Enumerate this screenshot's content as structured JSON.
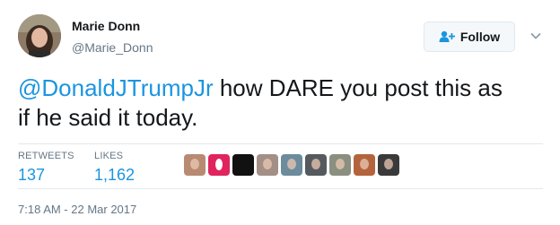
{
  "user": {
    "display_name": "Marie Donn",
    "handle": "@Marie_Donn"
  },
  "follow_button": {
    "label": "Follow",
    "icon": "person-add-icon"
  },
  "menu": {
    "icon": "chevron-down-icon"
  },
  "tweet": {
    "mention": "@DonaldJTrumpJr",
    "text_line1": " how DARE you post this as",
    "text_line2": "if he said it today."
  },
  "stats": {
    "retweets_label": "RETWEETS",
    "retweets_count": "137",
    "likes_label": "LIKES",
    "likes_count": "1,162"
  },
  "liker_avatars": [
    {
      "color": "#b88a72"
    },
    {
      "color": "#e0245e"
    },
    {
      "color": "#111111"
    },
    {
      "color": "#a48f86"
    },
    {
      "color": "#6c8b9c"
    },
    {
      "color": "#555a5e"
    },
    {
      "color": "#8a8f80"
    },
    {
      "color": "#b4643c"
    },
    {
      "color": "#3a3a3a"
    }
  ],
  "timestamp": "7:18 AM - 22 Mar 2017",
  "colors": {
    "link_blue": "#1b95e0",
    "text_dark": "#14171a",
    "text_gray": "#657786",
    "border": "#e1e8ed"
  }
}
